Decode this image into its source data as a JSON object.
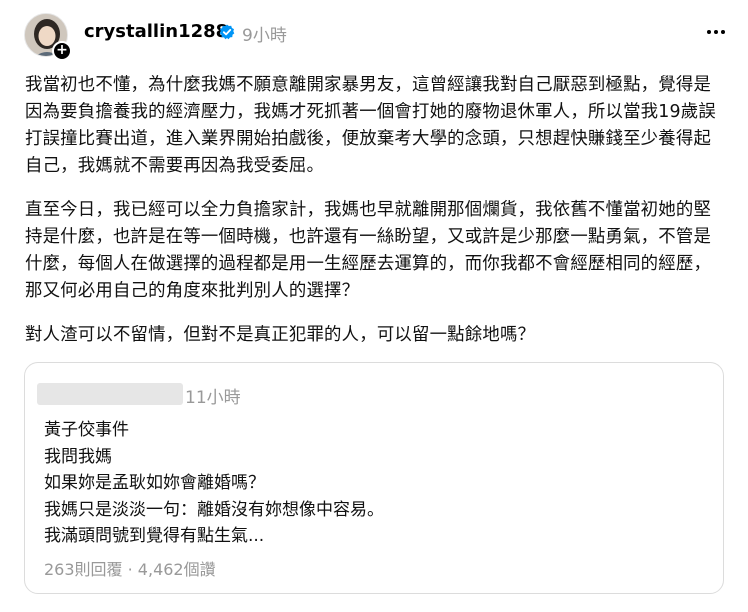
{
  "post": {
    "author": "crystallin1288",
    "time": "9小時",
    "paragraphs": [
      "我當初也不懂，為什麼我媽不願意離開家暴男友，這曾經讓我對自己厭惡到極點，覺得是因為要負擔養我的經濟壓力，我媽才死抓著一個會打她的廢物退休軍人，所以當我19歲誤打誤撞比賽出道，進入業界開始拍戲後，便放棄考大學的念頭，只想趕快賺錢至少養得起自己，我媽就不需要再因為我受委屈。",
      "直至今日，我已經可以全力負擔家計，我媽也早就離開那個爛貨，我依舊不懂當初她的堅持是什麼，也許是在等一個時機，也許還有一絲盼望，又或許是少那麼一點勇氣，不管是什麼，每個人在做選擇的過程都是用一生經歷去運算的，而你我都不會經歷相同的經歷，那又何必用自己的角度來批判別人的選擇？",
      "對人渣可以不留情，但對不是真正犯罪的人，可以留一點餘地嗎？"
    ]
  },
  "quoted": {
    "time": "11小時",
    "lines": [
      "黃子佼事件",
      "我問我媽",
      "如果妳是孟耿如妳會離婚嗎？",
      "我媽只是淡淡一句：離婚沒有妳想像中容易。",
      "我滿頭問號到覺得有點生氣..."
    ],
    "stats": "263則回覆 · 4,462個讚"
  },
  "icons": {
    "verified": "verified-badge-icon",
    "more": "more-options-icon",
    "follow": "follow-plus-icon"
  },
  "colors": {
    "verified": "#0095f6",
    "muted": "#999999"
  }
}
